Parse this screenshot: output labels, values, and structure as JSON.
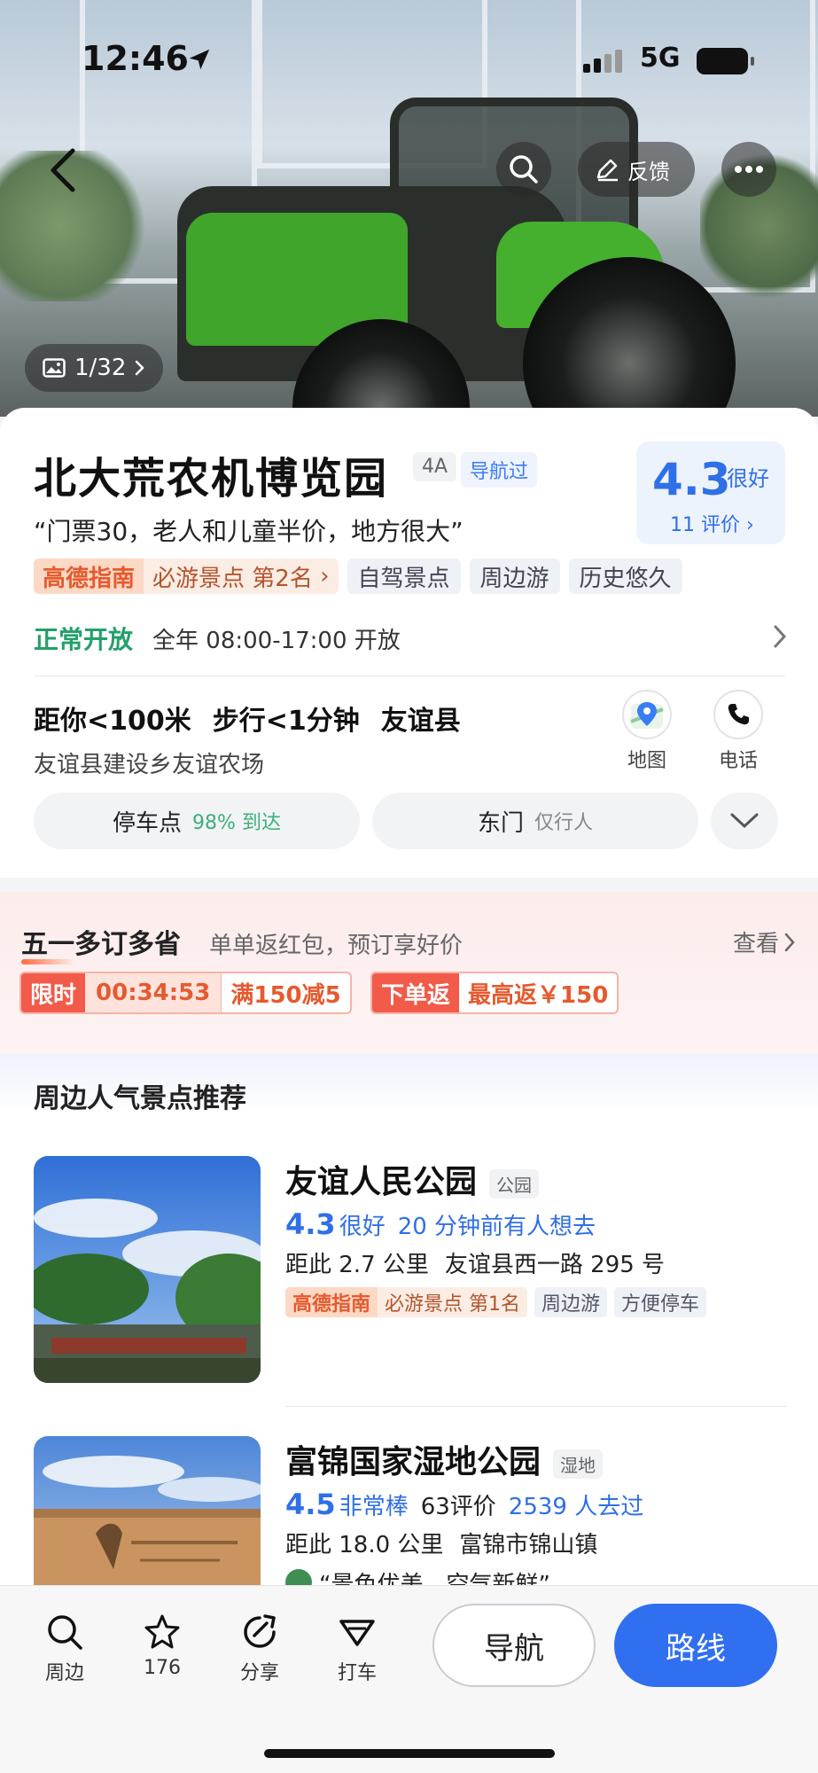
{
  "status_bar": {
    "time": "12:46",
    "network": "5G"
  },
  "hero": {
    "photo_count": "1/32",
    "feedback_label": "反馈"
  },
  "poi": {
    "title": "北大荒农机博览园",
    "tags": [
      "4A",
      "导航过"
    ],
    "rating": {
      "score": "4.3",
      "word": "很好",
      "count": "11 评价"
    },
    "quote": "“门票30，老人和儿童半价，地方很大”",
    "rank_chip": {
      "brand": "高德指南",
      "text": "必游景点 第2名"
    },
    "chips": [
      "自驾景点",
      "周边游",
      "历史悠久"
    ],
    "open_status": "正常开放",
    "hours": "全年 08:00-17:00 开放",
    "distance": [
      "距你<100米",
      "步行<1分钟",
      "友谊县"
    ],
    "address": "友谊县建设乡友谊农场",
    "actions": [
      "地图",
      "电话"
    ],
    "entrances": [
      {
        "name": "停车点",
        "sub": "98% 到达",
        "sub_color": "#3bb07b"
      },
      {
        "name": "东门",
        "sub": "仅行人",
        "sub_color": "#888888"
      }
    ]
  },
  "promo": {
    "title": "五一多订多省",
    "subtitle": "单单返红包，预订享好价",
    "see_label": "查看",
    "coupon1": {
      "label": "限时",
      "timer": "00:34:53",
      "value": "满150减5"
    },
    "coupon2": {
      "label": "下单返",
      "value": "最高返￥150"
    }
  },
  "recommend": {
    "title": "周边人气景点推荐",
    "items": [
      {
        "name": "友谊人民公园",
        "type": "公园",
        "score": "4.3",
        "score_word": "很好",
        "extra_blue": "20 分钟前有人想去",
        "distance": "距此 2.7 公里",
        "address": "友谊县西一路 295 号",
        "rank_brand": "高德指南",
        "rank_text": "必游景点 第1名",
        "chips": [
          "周边游",
          "方便停车"
        ]
      },
      {
        "name": "富锦国家湿地公园",
        "type": "湿地",
        "score": "4.5",
        "score_word": "非常棒",
        "reviews": "63评价",
        "extra_blue": "2539 人去过",
        "distance": "距此 18.0 公里",
        "address": "富锦市锦山镇",
        "quote": "“景色优美，空气新鲜”"
      }
    ]
  },
  "bottom_bar": {
    "tabs": [
      "周边",
      "176",
      "分享",
      "打车"
    ],
    "nav_label": "导航",
    "route_label": "路线"
  },
  "colors": {
    "accent": "#2f6ff0",
    "open": "#23a06b",
    "promo": "#f25a4a"
  }
}
